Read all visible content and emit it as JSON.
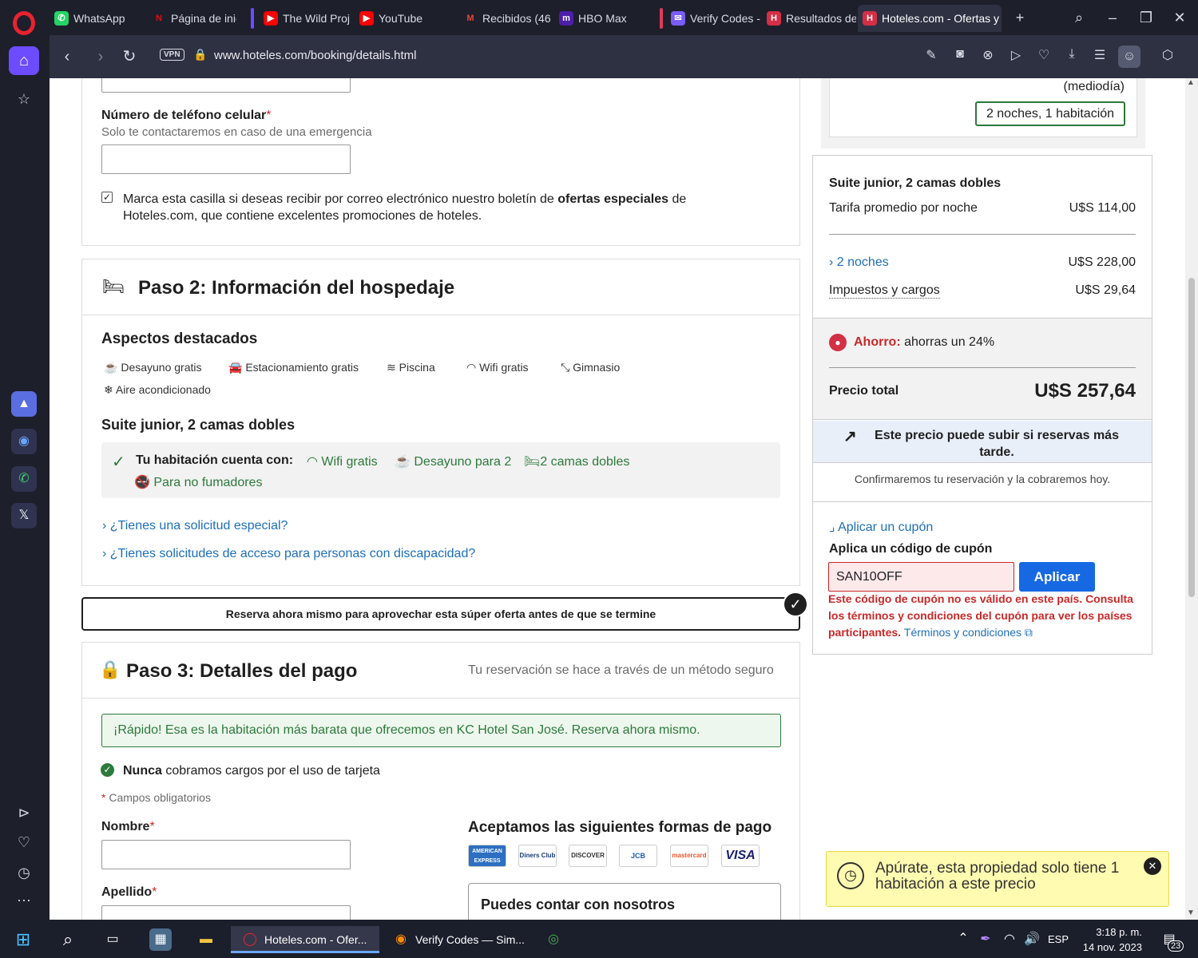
{
  "browser": {
    "tabs": [
      {
        "label": "WhatsApp",
        "favicon": "whatsapp-icon"
      },
      {
        "label": "Página de inic",
        "favicon": "netflix-icon"
      },
      {
        "label": "The Wild Proj",
        "favicon": "youtube-icon"
      },
      {
        "label": "YouTube",
        "favicon": "youtube-icon"
      },
      {
        "label": "Recibidos (46",
        "favicon": "gmail-icon"
      },
      {
        "label": "HBO Max",
        "favicon": "hbomax-icon"
      },
      {
        "label": "Verify Codes -",
        "favicon": "verify-codes-icon"
      },
      {
        "label": "Resultados de",
        "favicon": "hoteles-icon"
      },
      {
        "label": "Hoteles.com - Ofertas y",
        "favicon": "hoteles-icon"
      }
    ],
    "vpn_label": "VPN",
    "url": "www.hoteles.com/booking/details.html"
  },
  "form_top": {
    "phone_label": "Número de teléfono celular",
    "phone_required": "*",
    "phone_hint": "Solo te contactaremos en caso de una emergencia",
    "newsletter_text_1": "Marca esta casilla si deseas recibir por correo electrónico nuestro boletín de ",
    "newsletter_bold": "ofertas especiales",
    "newsletter_text_2": " de",
    "newsletter_text_3": "Hoteles.com, que contiene excelentes promociones de hoteles."
  },
  "step2": {
    "title": "Paso 2: Información del hospedaje",
    "highlights_title": "Aspectos destacados",
    "amenities": [
      "Desayuno gratis",
      "Estacionamiento gratis",
      "Piscina",
      "Wifi gratis",
      "Gimnasio",
      "Aire acondicionado"
    ],
    "room_title": "Suite junior, 2 camas dobles",
    "room_includes_label": "Tu habitación cuenta con:",
    "room_features": [
      "Wifi gratis",
      "Desayuno para 2",
      "2 camas dobles",
      "Para no fumadores"
    ],
    "special_request": "¿Tienes una solicitud especial?",
    "accessibility_request": "¿Tienes solicitudes de acceso para personas con discapacidad?"
  },
  "promo_banner": "Reserva ahora mismo para aprovechar esta súper oferta antes de que se termine",
  "step3": {
    "title": "Paso 3: Detalles del pago",
    "secure_note": "Tu reservación se hace a través de un método seguro",
    "cheapest_notice": "¡Rápido! Esa es la habitación más barata que ofrecemos en KC Hotel San José. Reserva ahora mismo.",
    "never_charge_bold": "Nunca",
    "never_charge_rest": " cobramos cargos por el uso de tarjeta",
    "required_note": "Campos obligatorios",
    "first_name_label": "Nombre",
    "last_name_label": "Apellido",
    "payment_methods_title": "Aceptamos las siguientes formas de pago",
    "payment_methods": [
      "AMERICAN EXPRESS",
      "Diners Club",
      "DISCOVER",
      "JCB",
      "mastercard",
      "VISA"
    ],
    "trust_title": "Puedes contar con nosotros"
  },
  "summary": {
    "checkout_time": "(mediodía)",
    "stay_badge": "2 noches, 1 habitación",
    "room_name": "Suite junior, 2 camas dobles",
    "avg_rate_label": "Tarifa promedio por noche",
    "avg_rate_value": "U$S 114,00",
    "nights_label": "2 noches",
    "nights_value": "U$S 228,00",
    "taxes_label": "Impuestos y cargos",
    "taxes_value": "U$S 29,64",
    "savings_label": "Ahorro:",
    "savings_text": " ahorras un 24%",
    "total_label": "Precio total",
    "total_value": "U$S 257,64",
    "price_warning": "Este precio puede subir si reservas más tarde.",
    "confirm_note": "Confirmaremos tu reservación y la cobraremos hoy.",
    "coupon_toggle": "Aplicar un cupón",
    "coupon_title": "Aplica un código de cupón",
    "coupon_value": "SAN10OFF",
    "coupon_button": "Aplicar",
    "coupon_error": "Este código de cupón no es válido en este país. Consulta los términos y condiciones del cupón para ver los países participantes.",
    "terms_link": "Términos y condiciones"
  },
  "urgency": {
    "message": "Apúrate, esta propiedad solo tiene 1 habitación a este precio"
  },
  "taskbar": {
    "apps": [
      {
        "label": "Hoteles.com - Ofer..."
      },
      {
        "label": "Verify Codes — Sim..."
      }
    ],
    "lang": "ESP",
    "time": "3:18 p. m.",
    "date": "14 nov. 2023",
    "notif_count": "23"
  },
  "colors": {
    "accent_blue": "#1d6fb8",
    "button_blue": "#1668e3",
    "error_red": "#c92828",
    "green": "#2c7a3c",
    "urgency_yellow": "#fffbb0",
    "opera_purple": "#6d4cff"
  }
}
